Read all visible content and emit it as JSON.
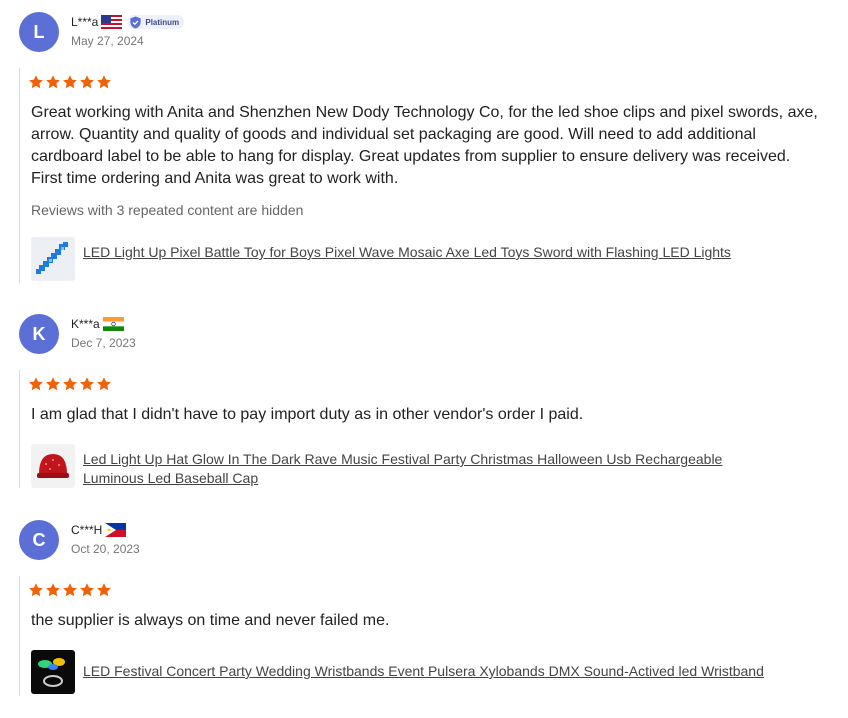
{
  "reviews": [
    {
      "initial": "L",
      "name": "L***a",
      "flag": "us-flag",
      "badge": "Platinum",
      "date": "May 27, 2024",
      "rating": 5,
      "text": "Great working with Anita and Shenzhen New Dody Technology Co, for the led shoe clips and pixel swords, axe, arrow. Quantity and quality of goods and individual set packaging are good. Will need to add additional cardboard label to be able to hang for display. Great updates from supplier to ensure delivery was received. First time ordering and Anita was great to work with.",
      "hidden_note": "Reviews with 3 repeated content are hidden",
      "product": "LED Light Up Pixel Battle Toy for Boys Pixel Wave Mosaic Axe Led Toys Sword with Flashing LED Lights"
    },
    {
      "initial": "K",
      "name": "K***a",
      "flag": "india-flag",
      "date": "Dec 7, 2023",
      "rating": 5,
      "text": "I am glad that I didn't have to pay import duty as in other vendor's order I paid.",
      "product": "Led Light Up Hat Glow In The Dark Rave Music Festival Party Christmas Halloween Usb Rechargeable Luminous Led Baseball Cap"
    },
    {
      "initial": "C",
      "name": "C***H",
      "flag": "philippines-flag",
      "date": "Oct 20, 2023",
      "rating": 5,
      "text": "the supplier is always on time and never failed me.",
      "product": "LED Festival Concert Party Wedding Wristbands Event Pulsera Xylobands DMX Sound-Actived led Wristband"
    }
  ],
  "colors": {
    "avatar": "#5b6fd6",
    "star": "#f0620a",
    "badge_bg": "#eef1fb"
  }
}
